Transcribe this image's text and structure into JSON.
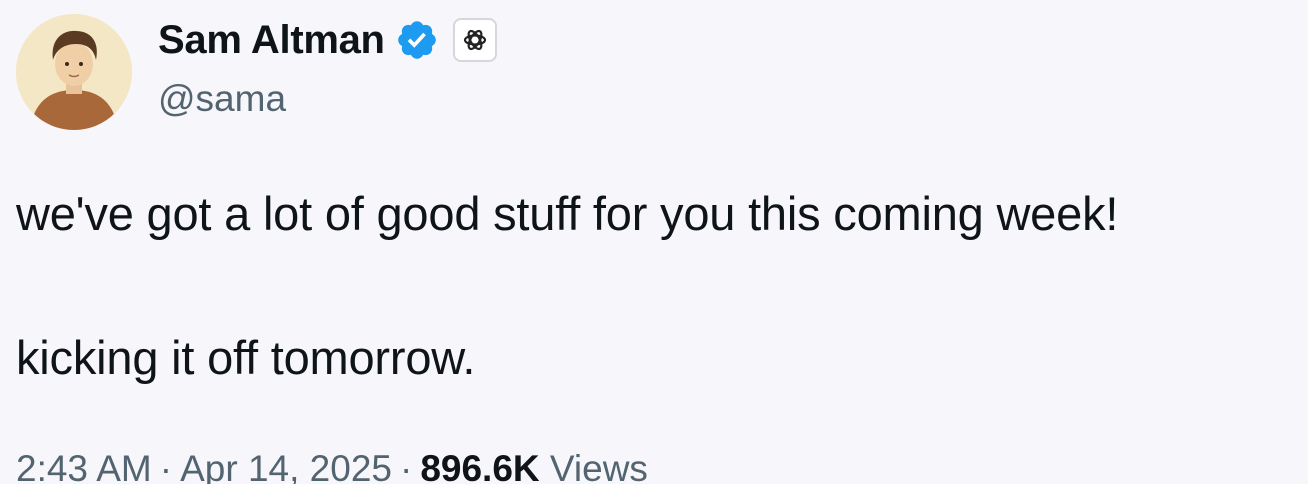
{
  "author": {
    "display_name": "Sam Altman",
    "handle": "@sama",
    "verified_icon": "verified-badge-icon",
    "affiliate_icon": "openai-logo-icon",
    "verified_color": "#1d9bf0"
  },
  "tweet": {
    "line_1": "we've got a lot of good stuff for you this coming week!",
    "line_2": "kicking it off tomorrow."
  },
  "meta": {
    "time": "2:43 AM",
    "separator": "·",
    "date": "Apr 14, 2025",
    "views_count": "896.6K",
    "views_label": "Views"
  }
}
